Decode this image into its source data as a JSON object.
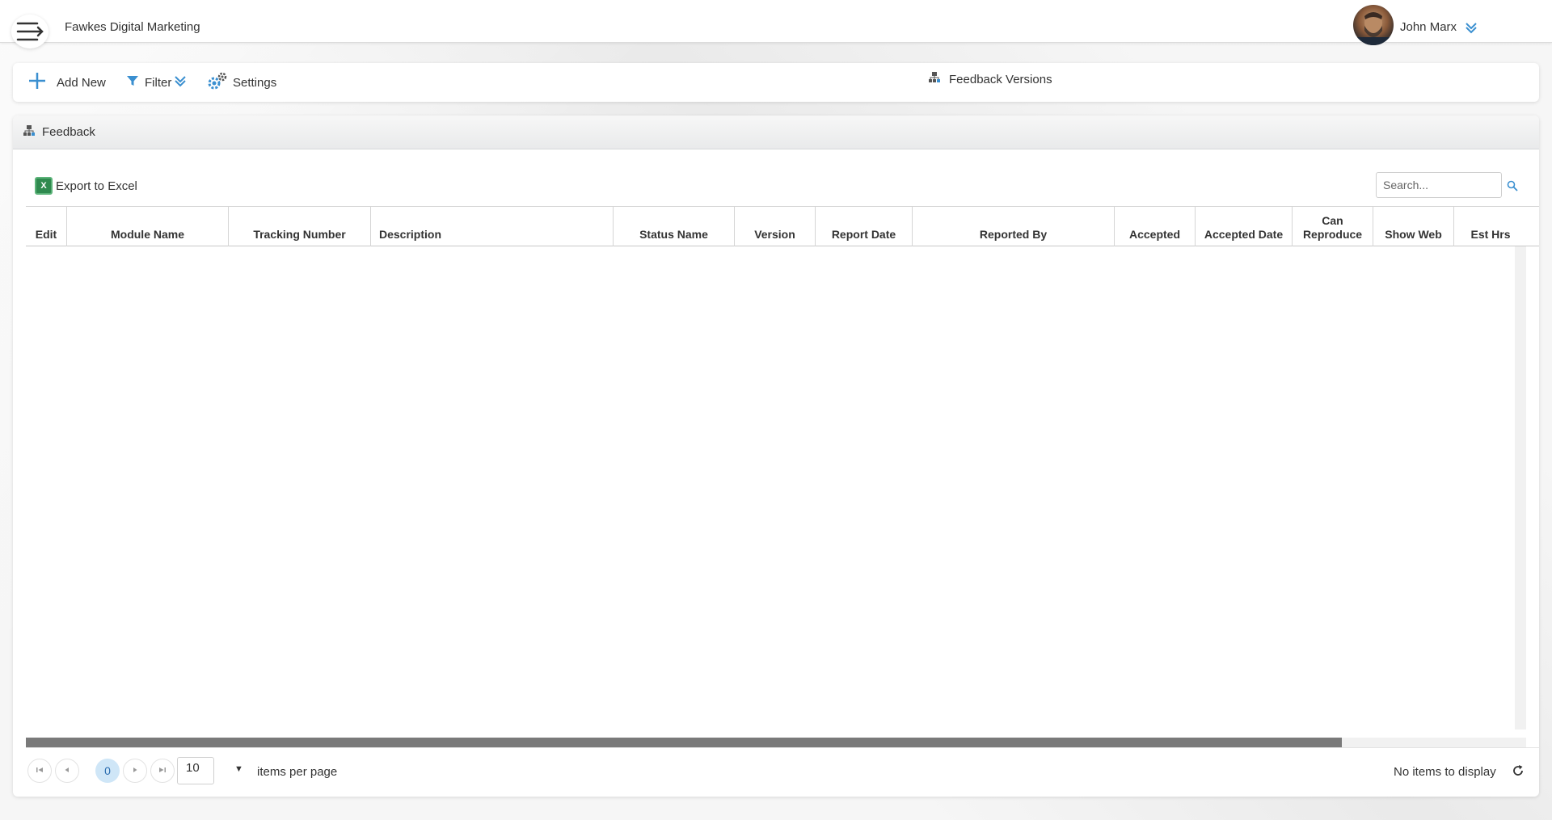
{
  "header": {
    "company": "Fawkes Digital Marketing",
    "user_name": "John Marx",
    "menu_icon": "menu-arrow-icon",
    "avatar_icon": "user-avatar"
  },
  "toolbar": {
    "add_new": "Add New",
    "filter": "Filter",
    "settings": "Settings",
    "center_title": "Feedback Versions"
  },
  "panel": {
    "title": "Feedback",
    "export_label": "Export to Excel",
    "search_placeholder": "Search..."
  },
  "table": {
    "columns": [
      "Edit",
      "Module Name",
      "Tracking Number",
      "Description",
      "Status Name",
      "Version",
      "Report Date",
      "Reported By",
      "Accepted",
      "Accepted Date",
      "Can Reproduce",
      "Show Web",
      "Est Hrs"
    ],
    "rows": []
  },
  "pager": {
    "current_page": "0",
    "page_size": "10",
    "items_per_page_label": "items per page",
    "info": "No items to display"
  },
  "colors": {
    "accent": "#2a8fd0",
    "excel_green": "#2f8a4f",
    "scroll_thumb": "#7a7a7a"
  }
}
